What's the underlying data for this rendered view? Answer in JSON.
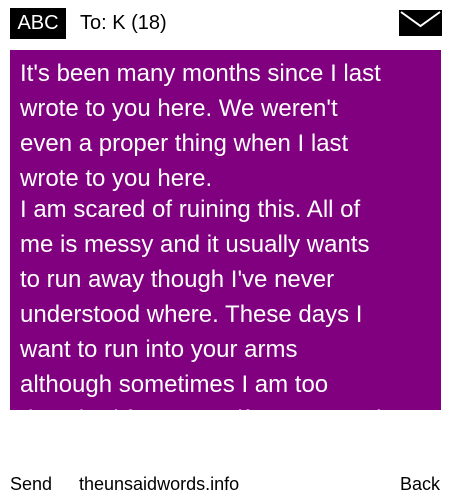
{
  "header": {
    "input_mode": "ABC",
    "recipient": "To: K (18)",
    "message_icon": "envelope-icon"
  },
  "message": {
    "background_color": "#800080",
    "paragraph_1": "It's been many months since I last\nwrote to you here. We weren't\neven a proper thing when I last\nwrote to you here.",
    "paragraph_2": "I am scared of ruining this. All of\nme is messy and it usually wants\nto run away though I've never\nunderstood where. These days I\nwant to run into your arms\nalthough sometimes I am too\ndetached from myself.I am scared"
  },
  "softkeys": {
    "left": "Send",
    "center": "theunsaidwords.info",
    "right": "Back"
  }
}
